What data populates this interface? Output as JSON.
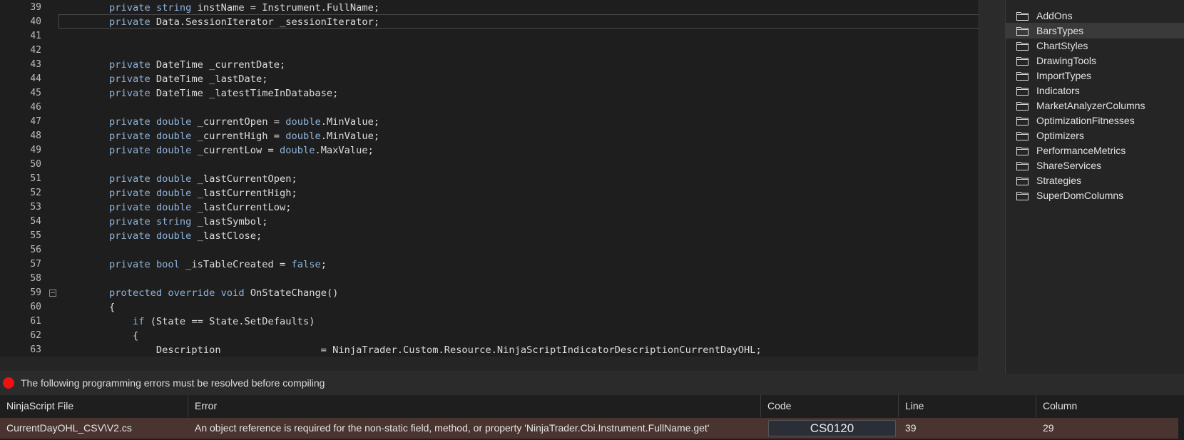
{
  "editor": {
    "lines": [
      {
        "no": "39",
        "code": "private string instName = Instrument.FullName;"
      },
      {
        "no": "40",
        "code": "private Data.SessionIterator _sessionIterator;"
      },
      {
        "no": "41",
        "code": ""
      },
      {
        "no": "42",
        "code": ""
      },
      {
        "no": "43",
        "code": "private DateTime _currentDate;"
      },
      {
        "no": "44",
        "code": "private DateTime _lastDate;"
      },
      {
        "no": "45",
        "code": "private DateTime _latestTimeInDatabase;"
      },
      {
        "no": "46",
        "code": ""
      },
      {
        "no": "47",
        "code": "private double _currentOpen = double.MinValue;"
      },
      {
        "no": "48",
        "code": "private double _currentHigh = double.MinValue;"
      },
      {
        "no": "49",
        "code": "private double _currentLow = double.MaxValue;"
      },
      {
        "no": "50",
        "code": ""
      },
      {
        "no": "51",
        "code": "private double _lastCurrentOpen;"
      },
      {
        "no": "52",
        "code": "private double _lastCurrentHigh;"
      },
      {
        "no": "53",
        "code": "private double _lastCurrentLow;"
      },
      {
        "no": "54",
        "code": "private string _lastSymbol;"
      },
      {
        "no": "55",
        "code": "private double _lastClose;"
      },
      {
        "no": "56",
        "code": ""
      },
      {
        "no": "57",
        "code": "private bool _isTableCreated = false;"
      },
      {
        "no": "58",
        "code": ""
      },
      {
        "no": "59",
        "code": "protected override void OnStateChange()"
      },
      {
        "no": "60",
        "code": "{"
      },
      {
        "no": "61",
        "code": "    if (State == State.SetDefaults)"
      },
      {
        "no": "62",
        "code": "    {"
      },
      {
        "no": "63",
        "code": "        Description                 = NinjaTrader.Custom.Resource.NinjaScriptIndicatorDescriptionCurrentDayOHL;"
      }
    ]
  },
  "tree": {
    "items": [
      {
        "label": "AddOns"
      },
      {
        "label": "BarsTypes"
      },
      {
        "label": "ChartStyles"
      },
      {
        "label": "DrawingTools"
      },
      {
        "label": "ImportTypes"
      },
      {
        "label": "Indicators"
      },
      {
        "label": "MarketAnalyzerColumns"
      },
      {
        "label": "OptimizationFitnesses"
      },
      {
        "label": "Optimizers"
      },
      {
        "label": "PerformanceMetrics"
      },
      {
        "label": "ShareServices"
      },
      {
        "label": "Strategies"
      },
      {
        "label": "SuperDomColumns"
      }
    ],
    "selected_item": "BarsTypes"
  },
  "errors": {
    "message": "The following programming errors must be resolved before compiling",
    "columns": [
      "NinjaScript File",
      "Error",
      "Code",
      "Line",
      "Column"
    ],
    "rows": [
      {
        "file": "CurrentDayOHL_CSV\\V2.cs",
        "error": "An object reference is required for the non-static field, method, or property 'NinjaTrader.Cbi.Instrument.FullName.get'",
        "code": "CS0120",
        "line": "39",
        "column": "29"
      }
    ]
  },
  "colors": {
    "editor_bg": "#1e1e1e",
    "keyword": "#8fb3d8",
    "error_icon": "#ee1111",
    "error_row_bg": "#4a3430"
  }
}
